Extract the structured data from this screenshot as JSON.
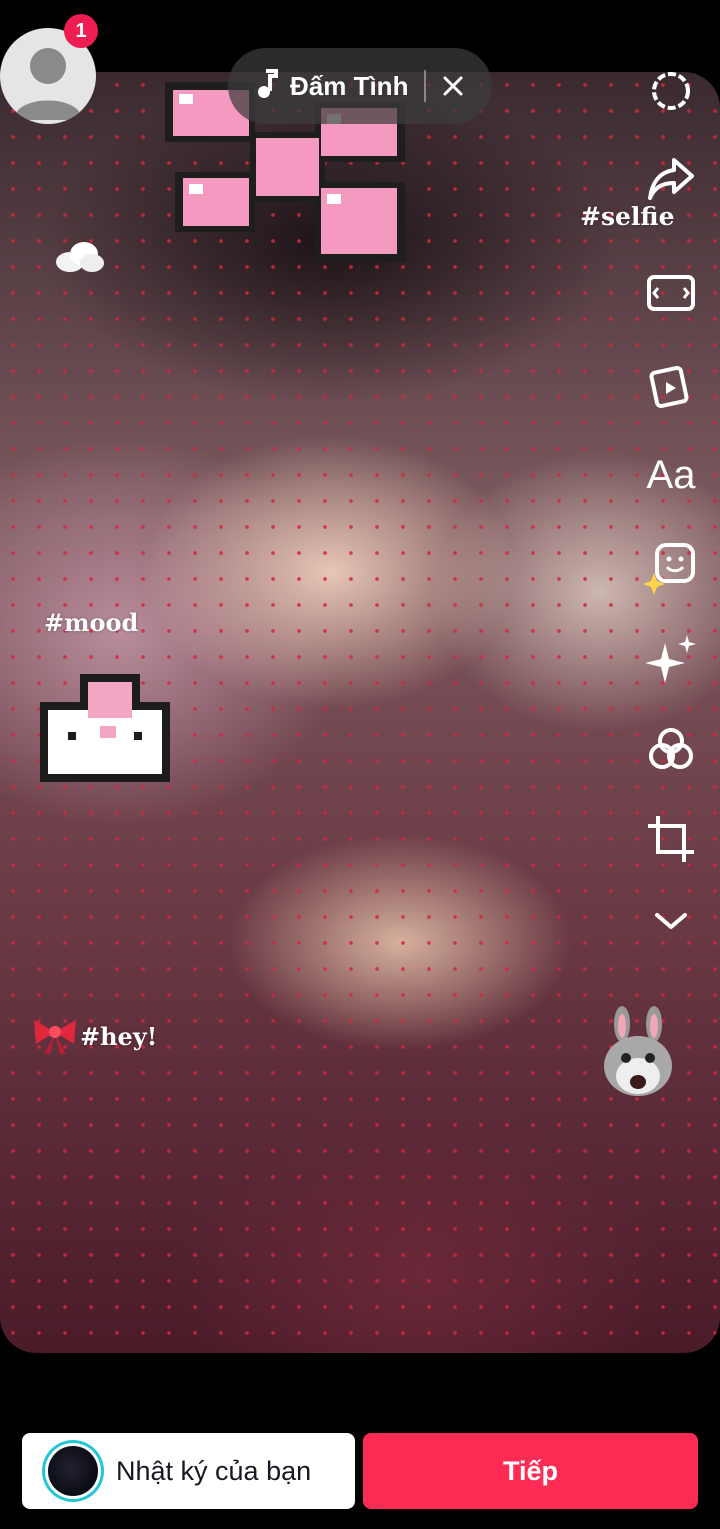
{
  "profile": {
    "notification_count": "1",
    "icon": "person-icon"
  },
  "music": {
    "title": "Đấm Tình",
    "note_icon": "music-note-icon",
    "close_icon": "close-icon"
  },
  "canvas": {
    "overlay_texts": {
      "selfie": "#selfie",
      "mood": "#mood",
      "hey": "#hey!"
    },
    "stickers": [
      "pixel-bow-sticker",
      "cloud-emoji",
      "pixel-bunny-sticker",
      "ribbon-emoji",
      "bunny-emoji"
    ]
  },
  "rail": {
    "items": [
      {
        "icon": "settings-gear-icon"
      },
      {
        "icon": "share-arrow-icon"
      },
      {
        "icon": "aspect-ratio-icon"
      },
      {
        "icon": "templates-icon"
      },
      {
        "icon": "text-icon",
        "label": "Aa"
      },
      {
        "icon": "stickers-icon"
      },
      {
        "icon": "effects-sparkle-icon"
      },
      {
        "icon": "filters-icon"
      },
      {
        "icon": "crop-icon"
      },
      {
        "icon": "chevron-down-icon"
      }
    ]
  },
  "bottom": {
    "journal_label": "Nhật ký của bạn",
    "next_label": "Tiếp"
  },
  "colors": {
    "accent": "#fe2c55",
    "badge": "#ee1d52",
    "ring": "#22c7d6",
    "dots": "#d2283c"
  }
}
